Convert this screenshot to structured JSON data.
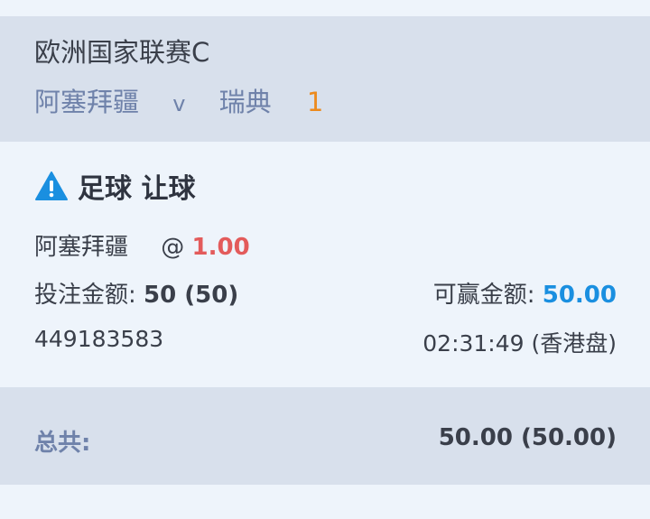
{
  "header": {
    "league": "欧洲国家联赛C",
    "home_team": "阿塞拜疆",
    "vs": "v",
    "away_team": "瑞典",
    "score": "1"
  },
  "bet": {
    "icon": "warning-icon",
    "type_label": "足球 让球",
    "selection": "阿塞拜疆",
    "at_symbol": "@",
    "odds": "1.00",
    "stake_label": "投注金额:",
    "stake_value": "50 (50)",
    "winnable_label": "可赢金额:",
    "winnable_value": "50.00",
    "ticket_id": "449183583",
    "time_info": "02:31:49 (香港盘)"
  },
  "footer": {
    "total_label": "总共:",
    "total_value": "50.00 (50.00)"
  },
  "colors": {
    "header_bg": "#d8e0ec",
    "body_bg": "#eef4fb",
    "team_text": "#6f82aa",
    "score": "#ec8a1d",
    "odds": "#e35b5b",
    "winnable": "#1a8fe0",
    "warning_icon": "#1a8fe0"
  }
}
